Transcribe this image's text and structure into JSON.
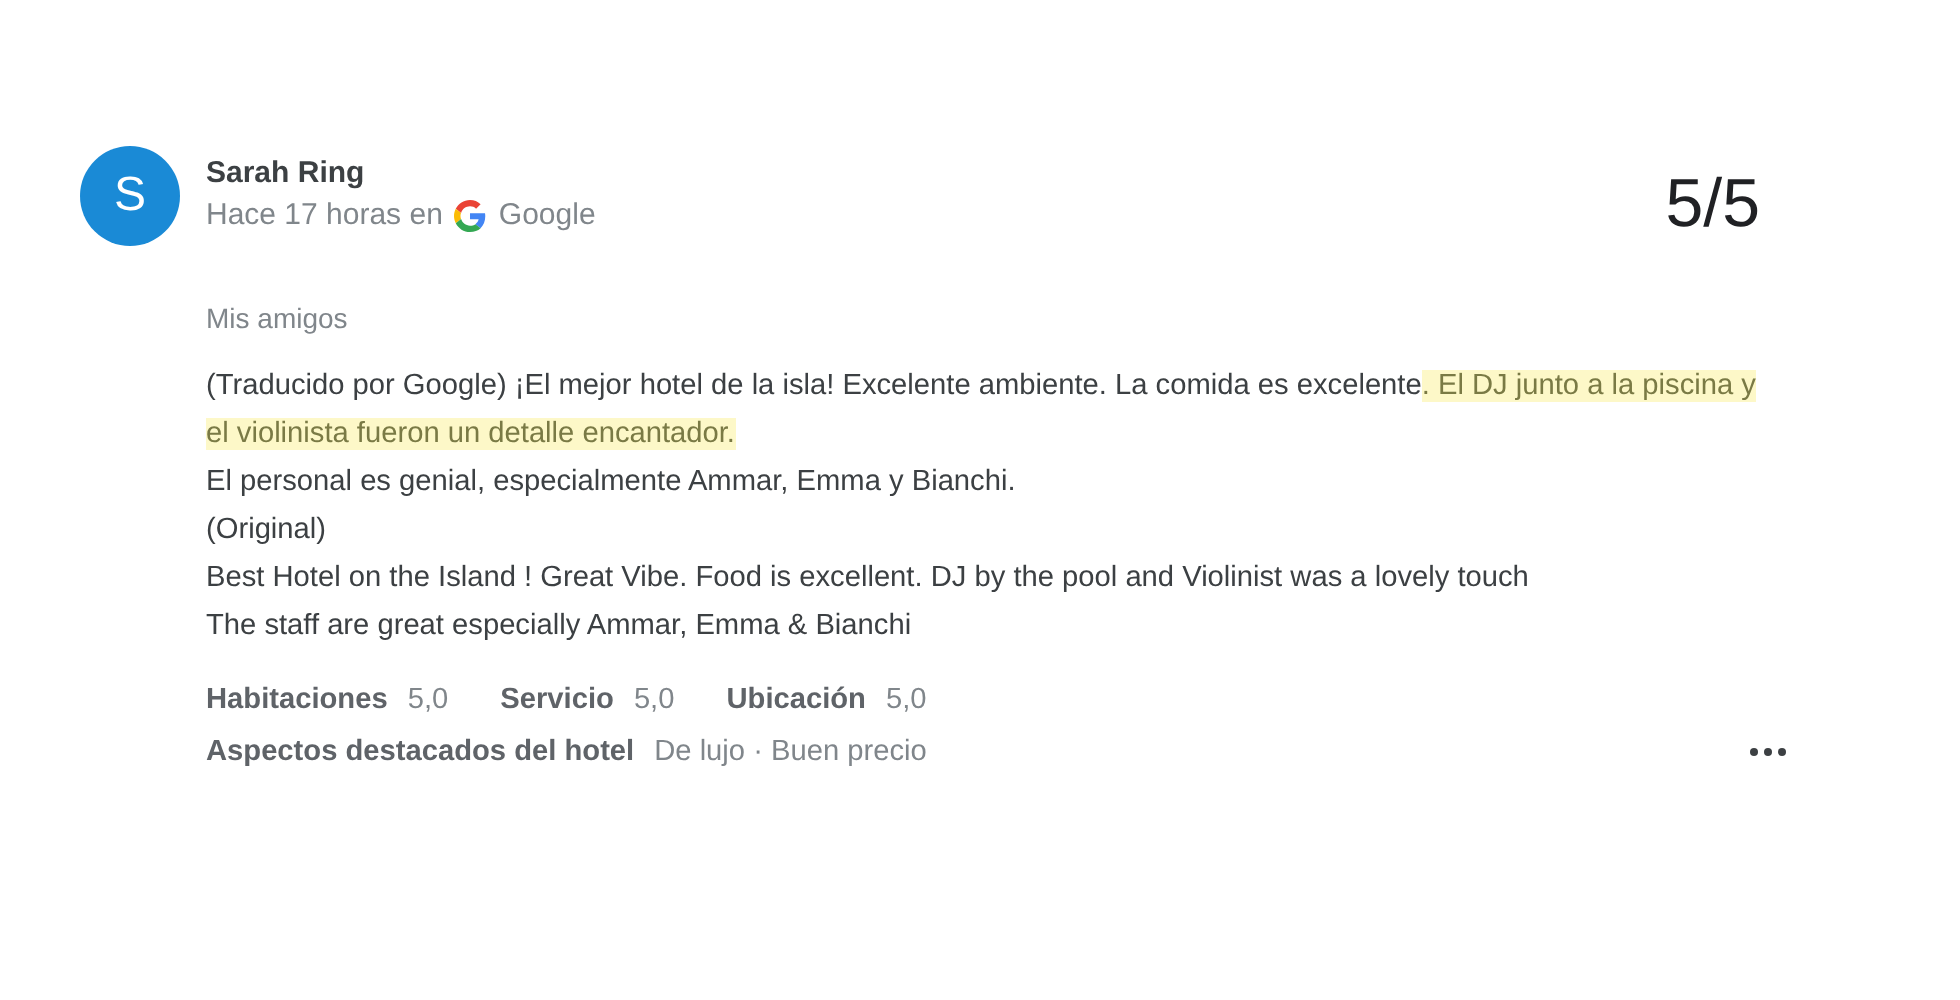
{
  "review": {
    "avatar_letter": "S",
    "author": "Sarah Ring",
    "time": "Hace 17 horas en",
    "source": "Google",
    "score": "5/5",
    "group": "Mis amigos",
    "paragraphs": [
      {
        "text": "(Traducido por Google) ¡El mejor hotel de la isla! Excelente ambiente. La comida es excelente",
        "highlight": ". El DJ junto a la piscina y el violinista fueron un detalle encantador."
      },
      {
        "text": "El personal es genial, especialmente Ammar, Emma y Bianchi."
      },
      {
        "text": "(Original)"
      },
      {
        "text": "Best Hotel on the Island ! Great Vibe. Food is excellent. DJ by the pool and Violinist was a lovely touch"
      },
      {
        "text": "The staff are great especially Ammar, Emma & Bianchi"
      }
    ],
    "ratings": [
      {
        "label": "Habitaciones",
        "value": "5,0"
      },
      {
        "label": "Servicio",
        "value": "5,0"
      },
      {
        "label": "Ubicación",
        "value": "5,0"
      }
    ],
    "highlights": {
      "label": "Aspectos destacados del hotel",
      "value": "De lujo · Buen precio"
    }
  }
}
